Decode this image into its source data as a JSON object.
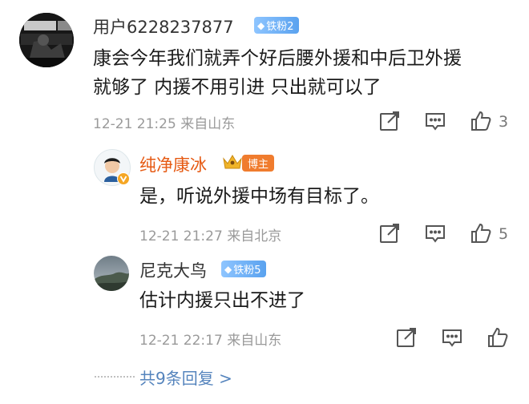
{
  "comment1": {
    "user": "用户6228237877",
    "badge": "铁粉2",
    "lines": [
      "康会今年我们就弄个好后腰外援和中后卫外援",
      "就够了 内援不用引进 只出就可以了"
    ],
    "meta": "12-21 21:25 来自山东",
    "likes": "3"
  },
  "reply1": {
    "user": "纯净康冰",
    "badge": "博主",
    "text": "是，听说外援中场有目标了。",
    "meta": "12-21 21:27 来自北京",
    "likes": "5"
  },
  "reply2": {
    "user": "尼克大鸟",
    "badge": "铁粉5",
    "text": "估计内援只出不进了",
    "meta": "12-21 22:17 来自山东",
    "likes": ""
  },
  "more_replies": "共9条回复 >",
  "icons": {
    "share": "share-icon",
    "comment": "comment-icon",
    "like": "like-icon",
    "gem": "diamond-icon",
    "crown": "crown-icon"
  },
  "colors": {
    "blogger_name": "#e65a13",
    "more_link": "#5584bd",
    "fan_badge": "#6aaef5",
    "host_badge": "#f07c2e"
  }
}
